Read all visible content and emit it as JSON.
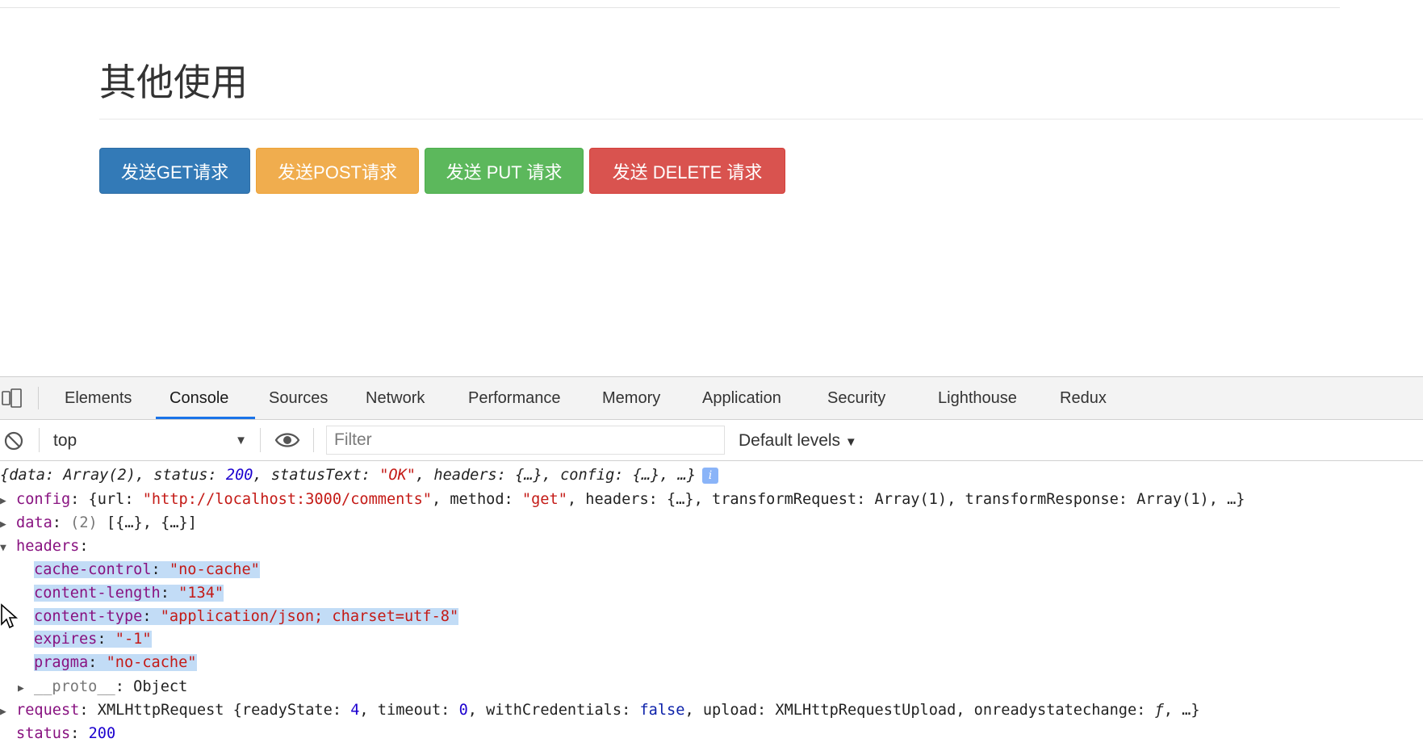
{
  "page": {
    "title": "其他使用",
    "buttons": {
      "get": "发送GET请求",
      "post": "发送POST请求",
      "put": "发送 PUT 请求",
      "delete": "发送 DELETE 请求"
    }
  },
  "devtools": {
    "tabs": [
      "Elements",
      "Console",
      "Sources",
      "Network",
      "Performance",
      "Memory",
      "Application",
      "Security",
      "Lighthouse",
      "Redux"
    ],
    "active_tab": "Console",
    "toolbar": {
      "context": "top",
      "filter_placeholder": "Filter",
      "levels": "Default levels"
    },
    "console": {
      "summary": {
        "open": "{data: Array(2), status: ",
        "status": "200",
        "mid1": ", statusText: ",
        "statusText": "\"OK\"",
        "rest": ", headers: {…}, config: {…}, …}"
      },
      "config": {
        "key": "config",
        "p1": ": {url: ",
        "url": "\"http://localhost:3000/comments\"",
        "p2": ", method: ",
        "method": "\"get\"",
        "p3": ", headers: {…}, transformRequest: Array(1), transformResponse: Array(1), …}"
      },
      "data": {
        "key": "data",
        "count": "(2)",
        "value": "[{…}, {…}]"
      },
      "headers_key": "headers",
      "headers": [
        {
          "key": "cache-control",
          "value": "\"no-cache\""
        },
        {
          "key": "content-length",
          "value": "\"134\""
        },
        {
          "key": "content-type",
          "value": "\"application/json; charset=utf-8\""
        },
        {
          "key": "expires",
          "value": "\"-1\""
        },
        {
          "key": "pragma",
          "value": "\"no-cache\""
        }
      ],
      "proto": {
        "key": "__proto__",
        "value": "Object"
      },
      "request": {
        "key": "request",
        "p1": ": XMLHttpRequest {readyState: ",
        "readyState": "4",
        "p2": ", timeout: ",
        "timeout": "0",
        "p3": ", withCredentials: ",
        "withCredentials": "false",
        "p4": ", upload: XMLHttpRequestUpload, onreadystatechange: ",
        "f": "ƒ",
        "p5": ", …}"
      },
      "status": {
        "key": "status",
        "value": "200"
      }
    }
  },
  "colors": {
    "get": "#337ab7",
    "post": "#f0ad4e",
    "put": "#5cb85c",
    "delete": "#d9534f",
    "active_tab_underline": "#1a73e8",
    "selection": "#c2dcf6"
  },
  "icons": [
    "device-toolbar-icon",
    "clear-console-icon",
    "eye-icon",
    "info-icon",
    "mouse-cursor-icon"
  ]
}
